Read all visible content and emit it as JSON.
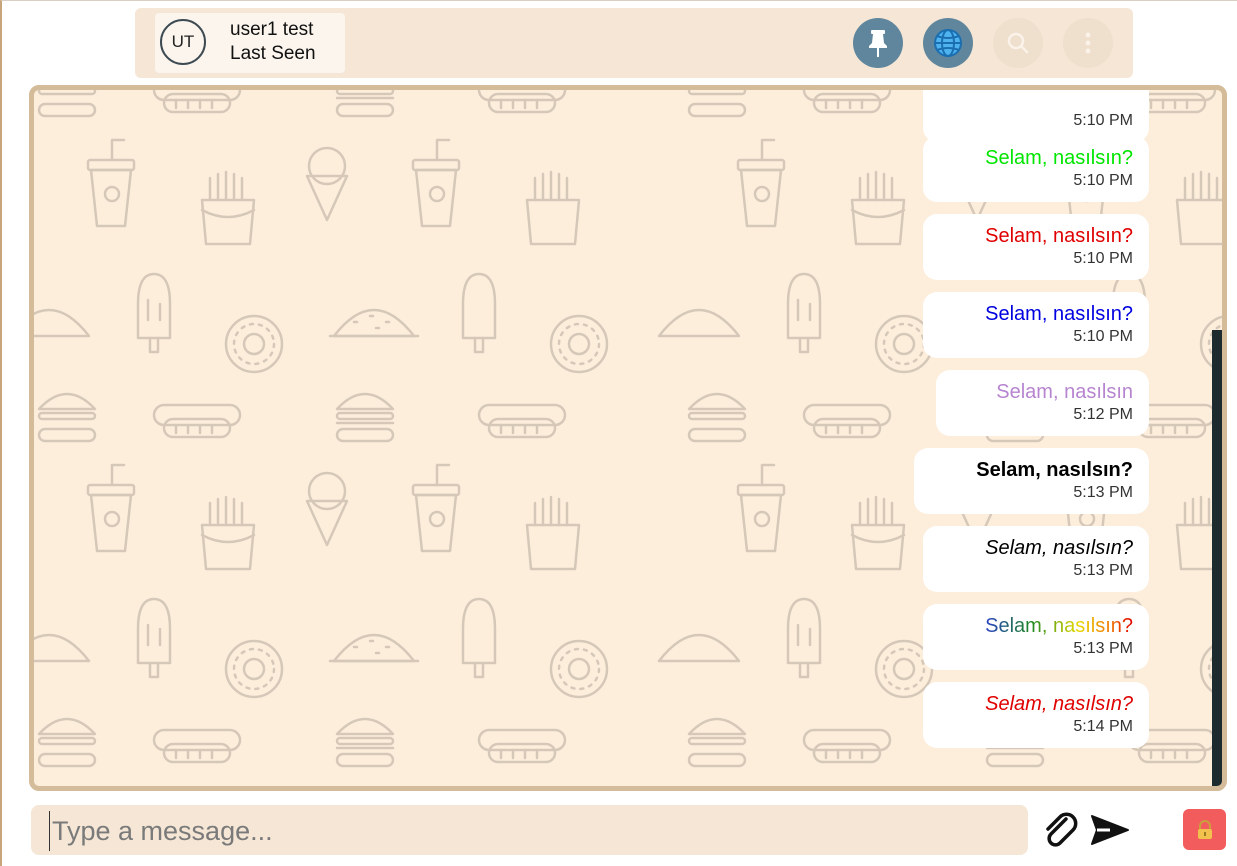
{
  "header": {
    "avatar_initials": "UT",
    "user_name": "user1 test",
    "user_status": "Last Seen",
    "buttons": [
      "pin-icon",
      "globe-icon",
      "search-icon",
      "more-vertical-icon"
    ],
    "accent_color": "#5f869c"
  },
  "messages": [
    {
      "text": "",
      "time": "5:10 PM",
      "color": "#000000"
    },
    {
      "text": "Selam, nasılsın?",
      "time": "5:10 PM",
      "color": "#00e600"
    },
    {
      "text": "Selam, nasılsın?",
      "time": "5:10 PM",
      "color": "#e00000"
    },
    {
      "text": "Selam, nasılsın?",
      "time": "5:10 PM",
      "color": "#0000e0"
    },
    {
      "text": "Selam, nasılsın",
      "time": "5:12 PM",
      "color": "#b784d0"
    },
    {
      "text": "Selam, nasılsın?",
      "time": "5:13 PM",
      "color": "#000000",
      "style": "bold"
    },
    {
      "text": "Selam, nasılsın?",
      "time": "5:13 PM",
      "color": "#000000",
      "style": "italic"
    },
    {
      "text": "Selam, nasılsın?",
      "time": "5:13 PM",
      "style": "rainbow"
    },
    {
      "text": "Selam, nasılsın?",
      "time": "5:14 PM",
      "color": "#e00000",
      "style": "italic"
    }
  ],
  "composer": {
    "placeholder": "Type a message...",
    "value": "",
    "attach_icon": "paperclip-icon",
    "send_icon": "send-icon",
    "lock_icon": "lock-icon",
    "lock_color": "#f25c5c"
  },
  "chat": {
    "background_color": "#fdeedc",
    "pattern": "food-doodle-pattern"
  }
}
